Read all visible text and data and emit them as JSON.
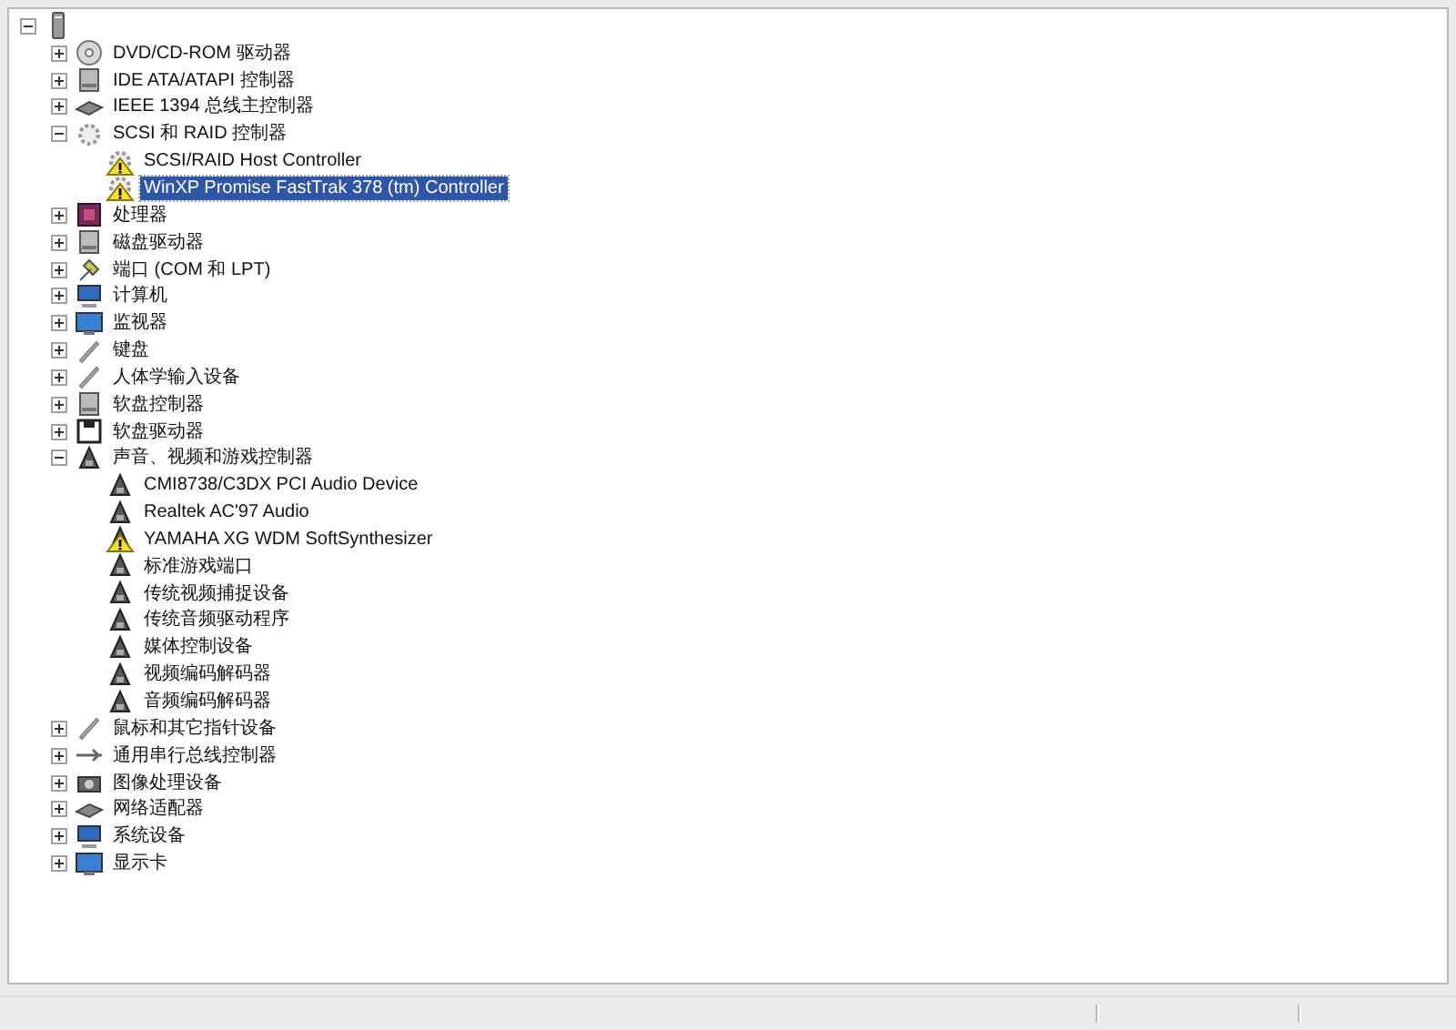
{
  "tree": {
    "kind": "tower",
    "expanded": true,
    "children": [
      {
        "label": "DVD/CD-ROM 驱动器",
        "kind": "disc",
        "expanded": false
      },
      {
        "label": "IDE ATA/ATAPI 控制器",
        "kind": "drive",
        "expanded": false
      },
      {
        "label": "IEEE 1394 总线主控制器",
        "kind": "card",
        "expanded": false
      },
      {
        "label": "SCSI 和 RAID 控制器",
        "kind": "gear",
        "expanded": true,
        "children": [
          {
            "label": "SCSI/RAID Host Controller",
            "kind": "gear",
            "warning": true,
            "selected": false
          },
          {
            "label": "WinXP Promise FastTrak 378 (tm) Controller",
            "kind": "gear",
            "warning": true,
            "selected": true
          }
        ]
      },
      {
        "label": "处理器",
        "kind": "chip",
        "expanded": false
      },
      {
        "label": "磁盘驱动器",
        "kind": "drive",
        "expanded": false
      },
      {
        "label": "端口 (COM 和 LPT)",
        "kind": "plug",
        "expanded": false
      },
      {
        "label": "计算机",
        "kind": "computer",
        "expanded": false
      },
      {
        "label": "监视器",
        "kind": "monitor",
        "expanded": false
      },
      {
        "label": "键盘",
        "kind": "pen",
        "expanded": false
      },
      {
        "label": "人体学输入设备",
        "kind": "pen",
        "expanded": false
      },
      {
        "label": "软盘控制器",
        "kind": "drive",
        "expanded": false
      },
      {
        "label": "软盘驱动器",
        "kind": "floppy",
        "expanded": false
      },
      {
        "label": "声音、视频和游戏控制器",
        "kind": "speaker",
        "expanded": true,
        "children": [
          {
            "label": "CMI8738/C3DX PCI Audio Device",
            "kind": "speaker",
            "warning": false,
            "selected": false
          },
          {
            "label": "Realtek AC'97 Audio",
            "kind": "speaker",
            "warning": false,
            "selected": false
          },
          {
            "label": "YAMAHA XG WDM SoftSynthesizer",
            "kind": "speaker",
            "warning": true,
            "selected": false
          },
          {
            "label": "标准游戏端口",
            "kind": "speaker",
            "warning": false,
            "selected": false
          },
          {
            "label": "传统视频捕捉设备",
            "kind": "speaker",
            "warning": false,
            "selected": false
          },
          {
            "label": "传统音频驱动程序",
            "kind": "speaker",
            "warning": false,
            "selected": false
          },
          {
            "label": "媒体控制设备",
            "kind": "speaker",
            "warning": false,
            "selected": false
          },
          {
            "label": "视频编码解码器",
            "kind": "speaker",
            "warning": false,
            "selected": false
          },
          {
            "label": "音频编码解码器",
            "kind": "speaker",
            "warning": false,
            "selected": false
          }
        ]
      },
      {
        "label": "鼠标和其它指针设备",
        "kind": "pen",
        "expanded": false
      },
      {
        "label": "通用串行总线控制器",
        "kind": "usb",
        "expanded": false
      },
      {
        "label": "图像处理设备",
        "kind": "camera",
        "expanded": false
      },
      {
        "label": "网络适配器",
        "kind": "card",
        "expanded": false
      },
      {
        "label": "系统设备",
        "kind": "computer",
        "expanded": false
      },
      {
        "label": "显示卡",
        "kind": "monitor",
        "expanded": false
      }
    ]
  }
}
